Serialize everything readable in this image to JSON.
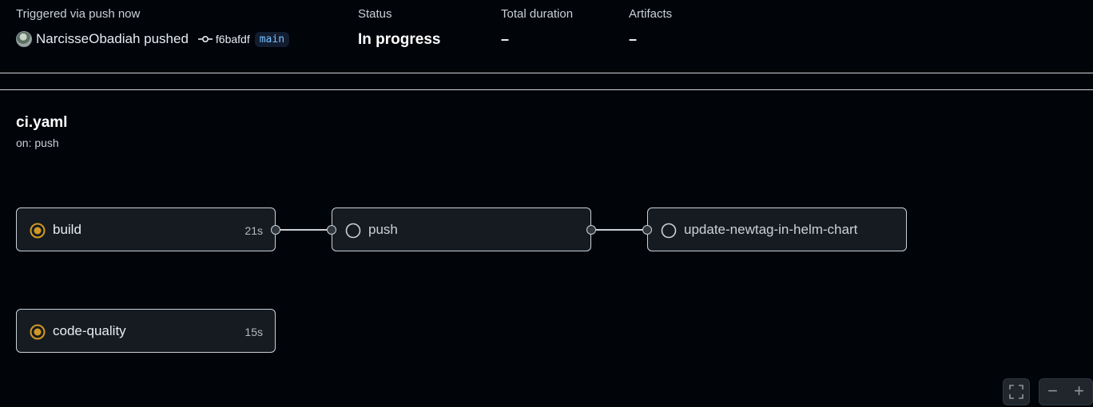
{
  "summary": {
    "trigger_label": "Triggered via push now",
    "actor": "NarcisseObadiah pushed",
    "commit_sha": "f6bafdf",
    "branch": "main",
    "status_label": "Status",
    "status_value": "In progress",
    "duration_label": "Total duration",
    "duration_value": "–",
    "artifacts_label": "Artifacts",
    "artifacts_value": "–"
  },
  "workflow": {
    "file": "ci.yaml",
    "trigger": "on: push"
  },
  "jobs": [
    {
      "name": "build",
      "duration": "21s",
      "status": "in-progress"
    },
    {
      "name": "push",
      "duration": "",
      "status": "queued"
    },
    {
      "name": "update-newtag-in-helm-chart",
      "duration": "",
      "status": "queued"
    },
    {
      "name": "code-quality",
      "duration": "15s",
      "status": "in-progress"
    }
  ],
  "controls": {
    "fit_icon": "fullscreen-icon",
    "zoom_out": "−",
    "zoom_in": "+"
  },
  "colors": {
    "background": "#010409",
    "in_progress": "#d29922",
    "card": "#161b22"
  }
}
